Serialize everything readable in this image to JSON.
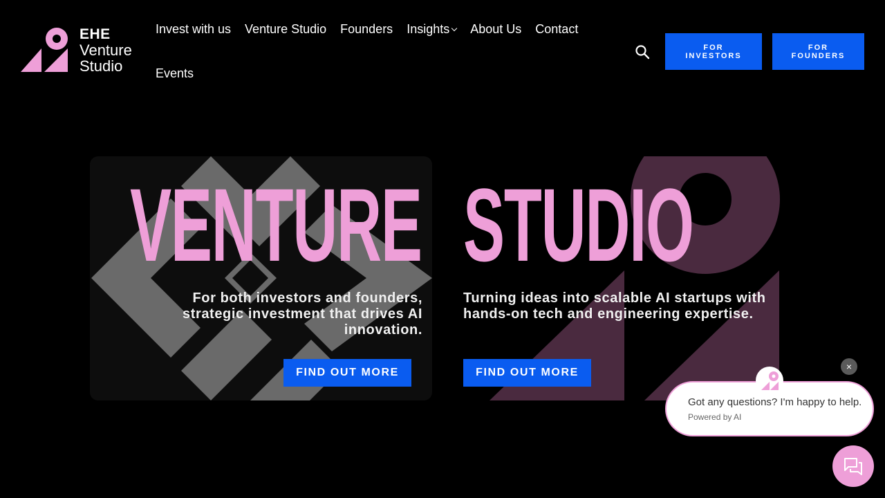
{
  "header": {
    "logo": {
      "line1": "EHE",
      "line2": "Venture",
      "line3": "Studio"
    },
    "nav": [
      "Invest with us",
      "Venture Studio",
      "Founders",
      "Insights",
      "About Us",
      "Contact",
      "Events"
    ],
    "search_icon": "search-icon",
    "btn_investors": [
      "FOR",
      "INVESTORS"
    ],
    "btn_founders": [
      "FOR",
      "FOUNDERS"
    ]
  },
  "hero": {
    "left": {
      "title": "VENTURE",
      "tagline": "For both investors and founders, strategic investment that drives AI innovation.",
      "cta": "FIND OUT MORE"
    },
    "right": {
      "title": "STUDIO",
      "tagline": "Turning ideas into scalable AI startups with hands-on tech and engineering expertise.",
      "cta": "FIND OUT MORE"
    }
  },
  "chat": {
    "close": "×",
    "question": "Got any questions? I'm happy to help.",
    "powered": "Powered by AI"
  },
  "colors": {
    "accent_pink": "#ee9fd8",
    "button_blue": "#0a5cf0",
    "background": "#000000"
  }
}
